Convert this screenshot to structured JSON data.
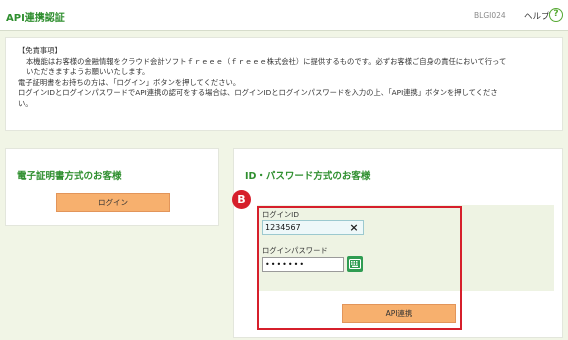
{
  "header": {
    "title": "API連携認証",
    "screen_id": "BLGI024",
    "help_label": "ヘルプ",
    "help_icon": "?"
  },
  "disclaimer": {
    "heading": "【免責事項】",
    "line1": "本機能はお客様の金融情報をクラウド会計ソフトｆｒｅｅｅ（ｆｒｅｅｅ株式会社）に提供するものです。必ずお客様ご自身の責任において行って",
    "line2": "いただきますようお願いいたします。",
    "line3": "電子証明書をお持ちの方は、「ログイン」ボタンを押してください。",
    "line4": "ログインIDとログインパスワードでAPI連携の認可をする場合は、ログインIDとログインパスワードを入力の上、「API連携」ボタンを押してくださ",
    "line5": "い。"
  },
  "cert_panel": {
    "title": "電子証明書方式のお客様",
    "login_button": "ログイン"
  },
  "id_panel": {
    "title": "ID・パスワード方式のお客様",
    "badge": "B",
    "login_id_label": "ログインID",
    "login_id_value": "1234567",
    "clear_icon": "×",
    "password_label": "ログインパスワード",
    "password_value": "•••••••",
    "api_button": "API連携"
  },
  "colors": {
    "accent_green": "#2f8f2f",
    "button_orange": "#f7b06e",
    "highlight_red": "#d61f2b",
    "background": "#f1f5e6"
  }
}
